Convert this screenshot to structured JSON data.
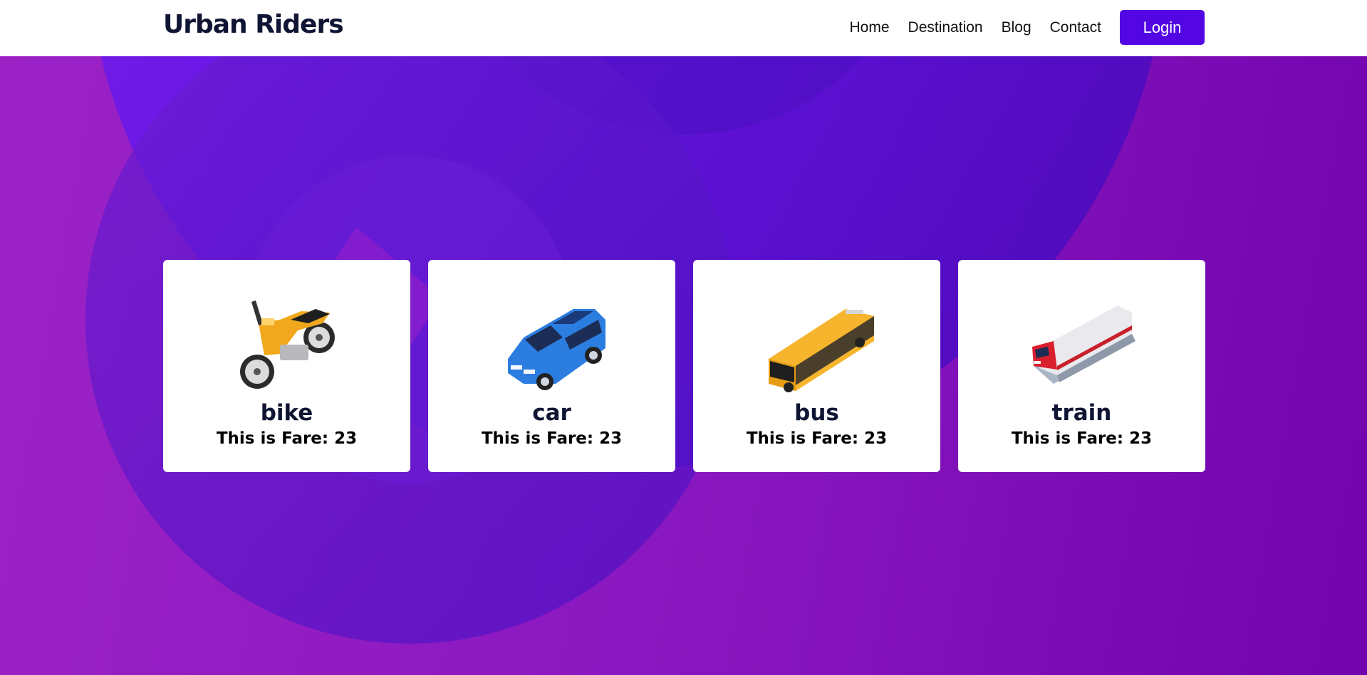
{
  "header": {
    "brand": "Urban Riders",
    "nav": [
      {
        "label": "Home"
      },
      {
        "label": "Destination"
      },
      {
        "label": "Blog"
      },
      {
        "label": "Contact"
      }
    ],
    "login_label": "Login"
  },
  "vehicles": [
    {
      "name": "bike",
      "fare_text": "This is Fare: 23",
      "icon": "motorbike-icon"
    },
    {
      "name": "car",
      "fare_text": "This is Fare: 23",
      "icon": "car-icon"
    },
    {
      "name": "bus",
      "fare_text": "This is Fare: 23",
      "icon": "bus-icon"
    },
    {
      "name": "train",
      "fare_text": "This is Fare: 23",
      "icon": "train-icon"
    }
  ],
  "colors": {
    "brand_text": "#0f1533",
    "login_button": "#5306e3",
    "hero_start": "#9c22c6",
    "hero_end": "#7204ad",
    "circle_blue": "#5a17ea"
  }
}
